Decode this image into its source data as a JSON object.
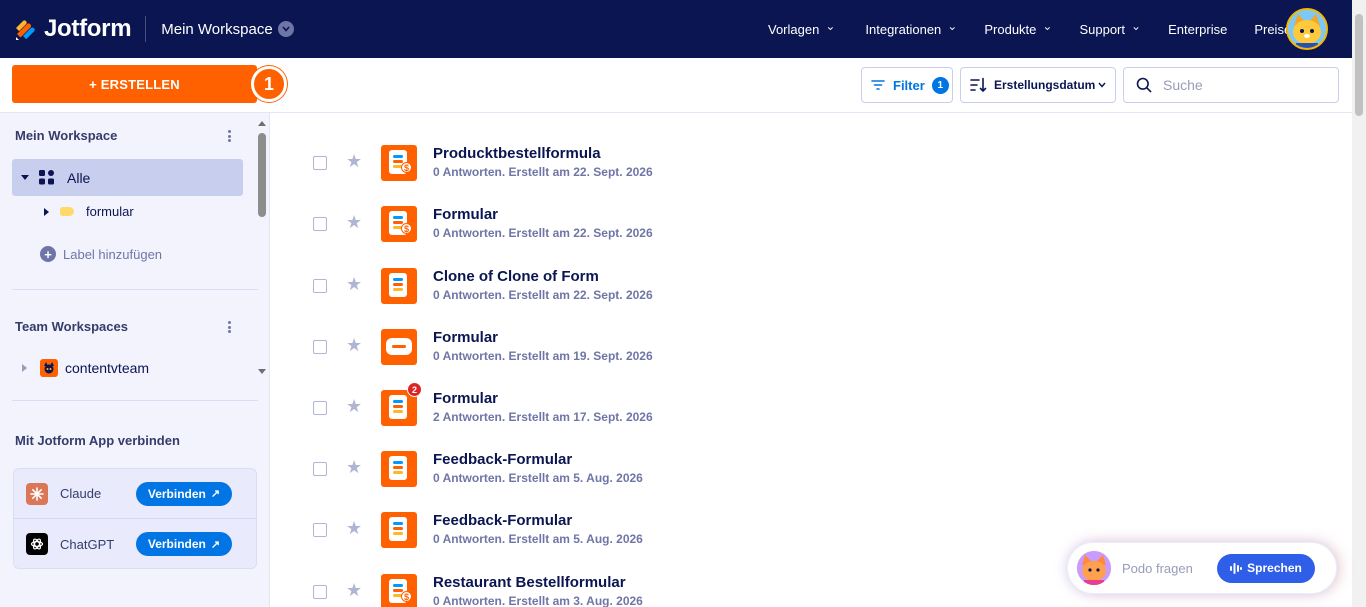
{
  "header": {
    "logo_text": "Jotform",
    "workspace": "Mein Workspace",
    "nav": [
      {
        "label": "Vorlagen",
        "caret": true
      },
      {
        "label": "Integrationen",
        "caret": true
      },
      {
        "label": "Produkte",
        "caret": true
      },
      {
        "label": "Support",
        "caret": true
      },
      {
        "label": "Enterprise",
        "caret": false
      },
      {
        "label": "Preise",
        "caret": false
      }
    ]
  },
  "toolbar": {
    "create_label": "+ ERSTELLEN",
    "step_badge": "1",
    "filter_label": "Filter",
    "filter_count": "1",
    "sort_label": "Erstellungsdatum",
    "search_placeholder": "Suche"
  },
  "sidebar": {
    "my_workspace_title": "Mein Workspace",
    "all_label": "Alle",
    "folder_label": "formular",
    "add_label": "Label hinzufügen",
    "team_title": "Team Workspaces",
    "team_name": "contentvteam",
    "connect_title": "Mit Jotform App verbinden",
    "apps": [
      {
        "name": "Claude",
        "button": "Verbinden",
        "color": "#d97757"
      },
      {
        "name": "ChatGPT",
        "button": "Verbinden",
        "color": "#000000"
      }
    ]
  },
  "forms": [
    {
      "title": "Producktbestellformula",
      "meta": "0 Antworten. Erstellt am 22. Sept. 2026",
      "icon": "payment-form-icon",
      "badge": ""
    },
    {
      "title": "Formular",
      "meta": "0 Antworten. Erstellt am 22. Sept. 2026",
      "icon": "payment-form-icon",
      "badge": ""
    },
    {
      "title": "Clone of Clone of Form",
      "meta": "0 Antworten. Erstellt am 22. Sept. 2026",
      "icon": "form-icon",
      "badge": ""
    },
    {
      "title": "Formular",
      "meta": "0 Antworten. Erstellt am 19. Sept. 2026",
      "icon": "card-form-icon",
      "badge": ""
    },
    {
      "title": "Formular",
      "meta": "2 Antworten. Erstellt am 17. Sept. 2026",
      "icon": "form-icon",
      "badge": "2"
    },
    {
      "title": "Feedback-Formular",
      "meta": "0 Antworten. Erstellt am 5. Aug. 2026",
      "icon": "form-icon",
      "badge": ""
    },
    {
      "title": "Feedback-Formular",
      "meta": "0 Antworten. Erstellt am 5. Aug. 2026",
      "icon": "form-icon",
      "badge": ""
    },
    {
      "title": "Restaurant Bestellformular",
      "meta": "0 Antworten. Erstellt am 3. Aug. 2026",
      "icon": "payment-form-icon",
      "badge": ""
    }
  ],
  "podo": {
    "prompt": "Podo fragen",
    "speak_label": "Sprechen"
  },
  "colors": {
    "nav_bg": "#0a1551",
    "accent": "#ff6100",
    "link_blue": "#0075e3"
  }
}
